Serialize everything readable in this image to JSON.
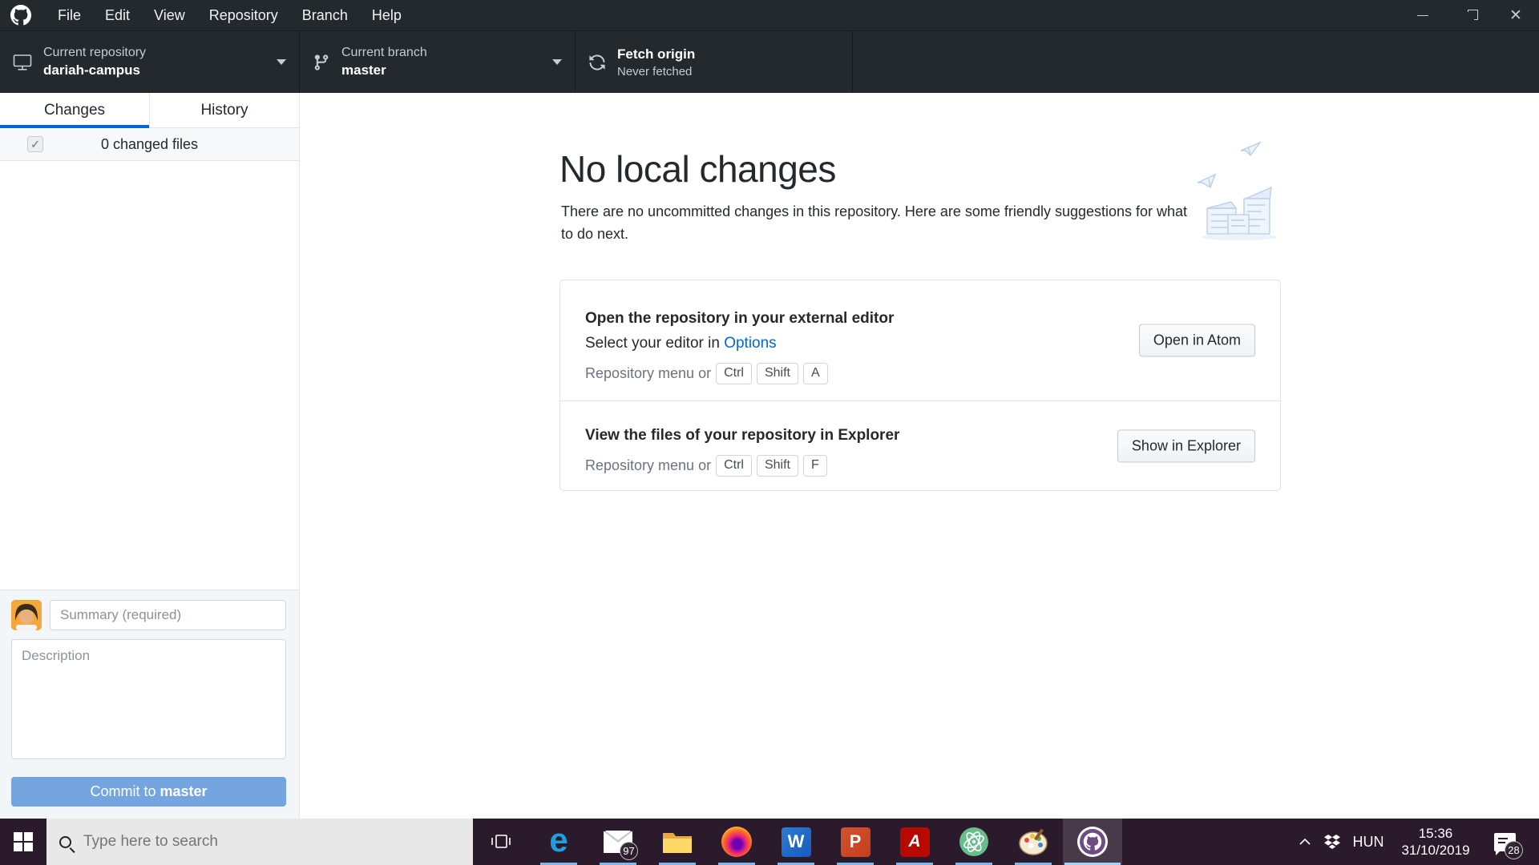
{
  "window": {
    "menus": [
      "File",
      "Edit",
      "View",
      "Repository",
      "Branch",
      "Help"
    ],
    "controls": {
      "close_glyph": "✕"
    }
  },
  "toolbar": {
    "repository": {
      "label": "Current repository",
      "value": "dariah-campus"
    },
    "branch": {
      "label": "Current branch",
      "value": "master"
    },
    "fetch": {
      "title": "Fetch origin",
      "subtitle": "Never fetched"
    }
  },
  "sidebar": {
    "tabs": [
      {
        "label": "Changes"
      },
      {
        "label": "History"
      }
    ],
    "files_summary": "0 changed files",
    "checkbox_glyph": "✓",
    "commit": {
      "summary_placeholder": "Summary (required)",
      "description_placeholder": "Description",
      "button_prefix": "Commit to ",
      "branch": "master"
    }
  },
  "main": {
    "heading": "No local changes",
    "subtitle": "There are no uncommitted changes in this repository. Here are some friendly suggestions for what to do next.",
    "cards": [
      {
        "title": "Open the repository in your external editor",
        "line_prefix": "Select your editor in ",
        "link": "Options",
        "shortcut_prefix": "Repository menu or",
        "keys": [
          "Ctrl",
          "Shift",
          "A"
        ],
        "button": "Open in Atom"
      },
      {
        "title": "View the files of your repository in Explorer",
        "shortcut_prefix": "Repository menu or",
        "keys": [
          "Ctrl",
          "Shift",
          "F"
        ],
        "button": "Show in Explorer"
      }
    ]
  },
  "taskbar": {
    "search_placeholder": "Type here to search",
    "glyphs": {
      "edge": "e",
      "word": "W",
      "powerpoint": "P",
      "acrobat": "A"
    },
    "mail_badge": "97",
    "tray": {
      "language": "HUN",
      "time": "15:36",
      "date": "31/10/2019",
      "notification_badge": "28"
    }
  },
  "colors": {
    "titlebar": "#24292e",
    "accent_blue": "#0366d6",
    "commit_button": "#74a5de",
    "taskbar": "#2b1a2c",
    "tab_underline": "#0366d6",
    "running_indicator": "#7cb9ea"
  }
}
